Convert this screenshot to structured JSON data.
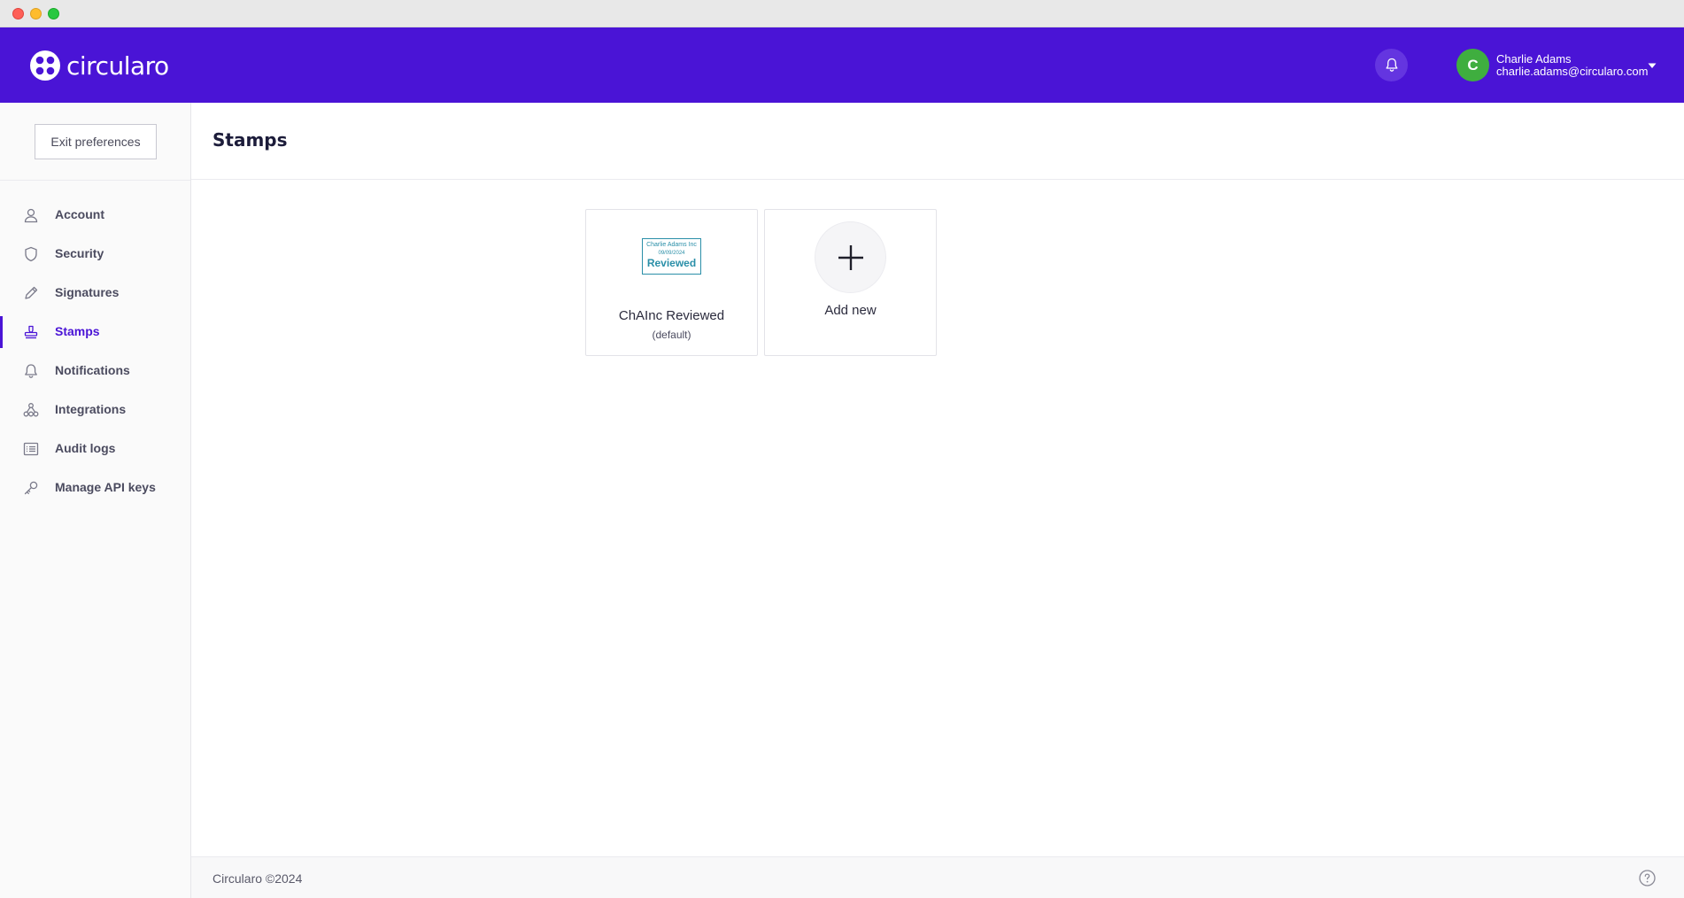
{
  "app": {
    "name": "circularo"
  },
  "user": {
    "initial": "C",
    "name": "Charlie Adams",
    "email": "charlie.adams@circularo.com"
  },
  "sidebar": {
    "exit_label": "Exit preferences",
    "items": [
      {
        "label": "Account",
        "icon": "user-icon"
      },
      {
        "label": "Security",
        "icon": "shield-icon"
      },
      {
        "label": "Signatures",
        "icon": "pen-icon"
      },
      {
        "label": "Stamps",
        "icon": "stamp-icon",
        "active": true
      },
      {
        "label": "Notifications",
        "icon": "bell-icon"
      },
      {
        "label": "Integrations",
        "icon": "integrations-icon"
      },
      {
        "label": "Audit logs",
        "icon": "list-icon"
      },
      {
        "label": "Manage API keys",
        "icon": "key-icon"
      }
    ]
  },
  "page": {
    "title": "Stamps"
  },
  "stamps": [
    {
      "name": "ChAInc Reviewed",
      "note": "(default)",
      "preview": {
        "company": "Charlie Adams Inc",
        "date": "09/09/2024",
        "word": "Reviewed"
      }
    }
  ],
  "add_new": {
    "label": "Add new"
  },
  "footer": {
    "text": "Circularo ©2024"
  },
  "colors": {
    "brand": "#4a14d6",
    "avatar": "#3fae3f",
    "stamp": "#2a8fa8"
  }
}
